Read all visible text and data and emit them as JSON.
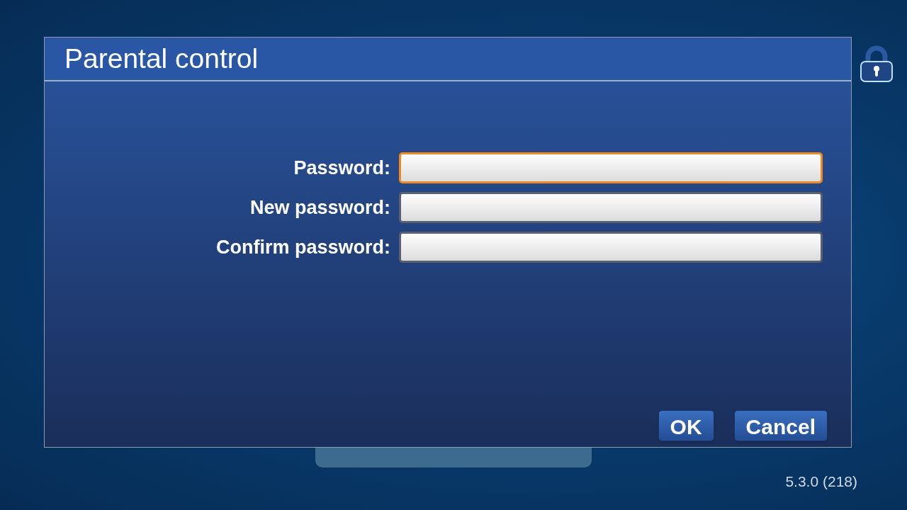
{
  "version": "5.3.0 (218)",
  "dialog": {
    "title": "Parental control",
    "fields": [
      {
        "label": "Password:",
        "focused": true
      },
      {
        "label": "New password:",
        "focused": false
      },
      {
        "label": "Confirm password:",
        "focused": false
      }
    ],
    "buttons": [
      "OK",
      "Cancel"
    ]
  }
}
